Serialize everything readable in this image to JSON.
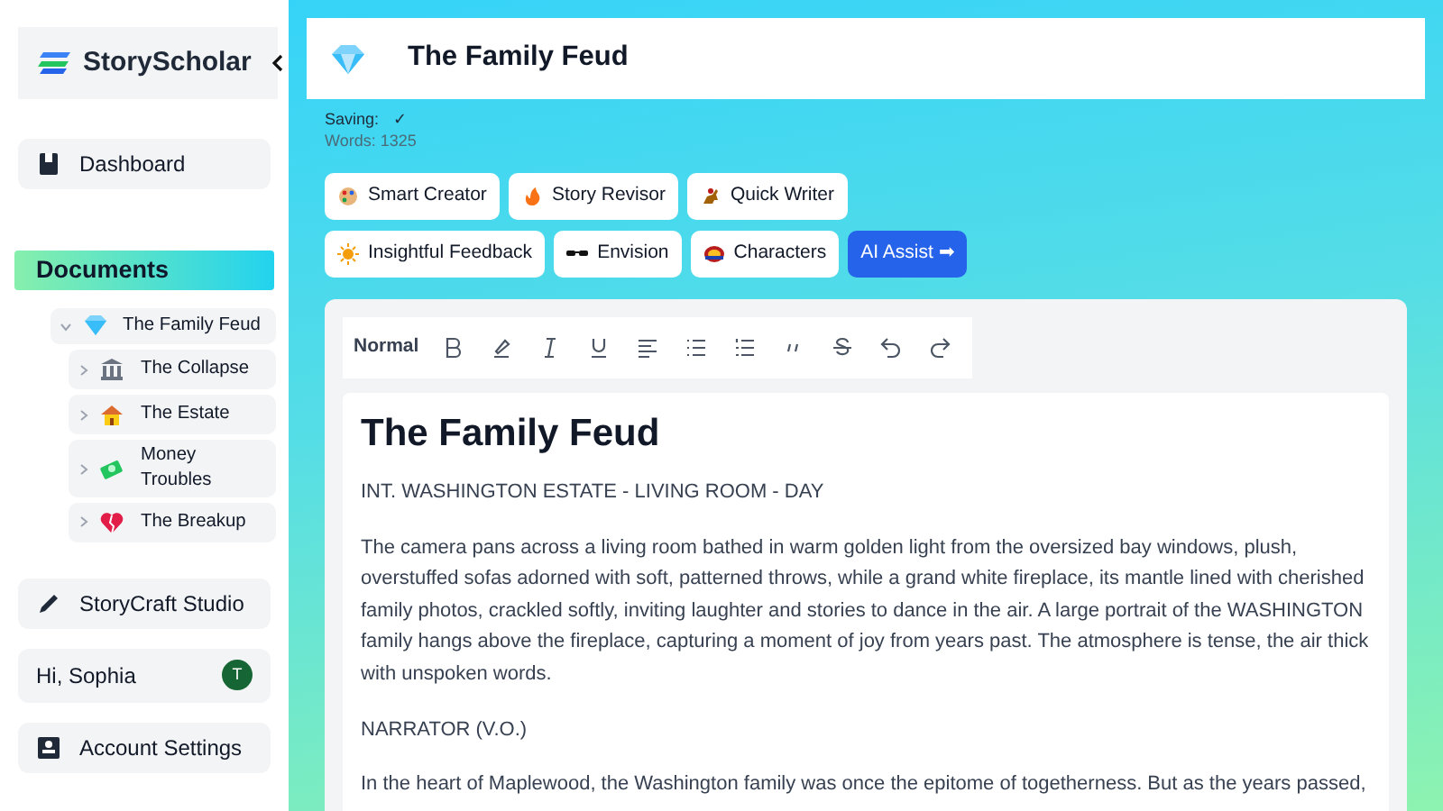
{
  "sidebar": {
    "brand": "StoryScholar",
    "nav_top": [
      {
        "label": "Dashboard"
      }
    ],
    "documents_heading": "Documents",
    "documents": [
      {
        "label": "The Family Feud",
        "expanded": true,
        "children": [
          {
            "label": "The Collapse",
            "expanded": false
          },
          {
            "label": "The Estate",
            "expanded": false
          },
          {
            "label": "Money Troubles",
            "expanded": false
          },
          {
            "label": "The Breakup",
            "expanded": false
          }
        ]
      }
    ],
    "studio": {
      "label": "StoryCraft Studio"
    },
    "user": {
      "greeting": "Hi, Sophia",
      "avatar_letter": "T"
    },
    "account": {
      "label": "Account Settings"
    }
  },
  "header": {
    "title": "The Family Feud"
  },
  "status": {
    "saving_label": "Saving:",
    "saving_mark": "✓",
    "words": "Words: 1325"
  },
  "tools": [
    {
      "label": "Smart Creator",
      "primary": false
    },
    {
      "label": "Story Revisor",
      "primary": false
    },
    {
      "label": "Quick Writer",
      "primary": false
    },
    {
      "label": "Insightful Feedback",
      "primary": false
    },
    {
      "label": "Envision",
      "primary": false
    },
    {
      "label": "Characters",
      "primary": false
    },
    {
      "label": "AI Assist ➡",
      "primary": true
    }
  ],
  "editor": {
    "format": "Normal",
    "heading": "The Family Feud",
    "paragraphs": [
      "INT. WASHINGTON ESTATE - LIVING ROOM - DAY",
      "The camera pans across a living room bathed in warm golden light from the oversized bay windows, plush, overstuffed sofas adorned with soft, patterned throws, while a grand white fireplace, its mantle lined with cherished family photos, crackled softly, inviting laughter and stories to dance in the air. A large portrait of the WASHINGTON family hangs above the fireplace, capturing a moment of joy from years past. The atmosphere is tense, the air thick with unspoken words.",
      "NARRATOR (V.O.)",
      "In the heart of Maplewood, the Washington family was once the epitome of togetherness. But as the years passed,"
    ]
  }
}
